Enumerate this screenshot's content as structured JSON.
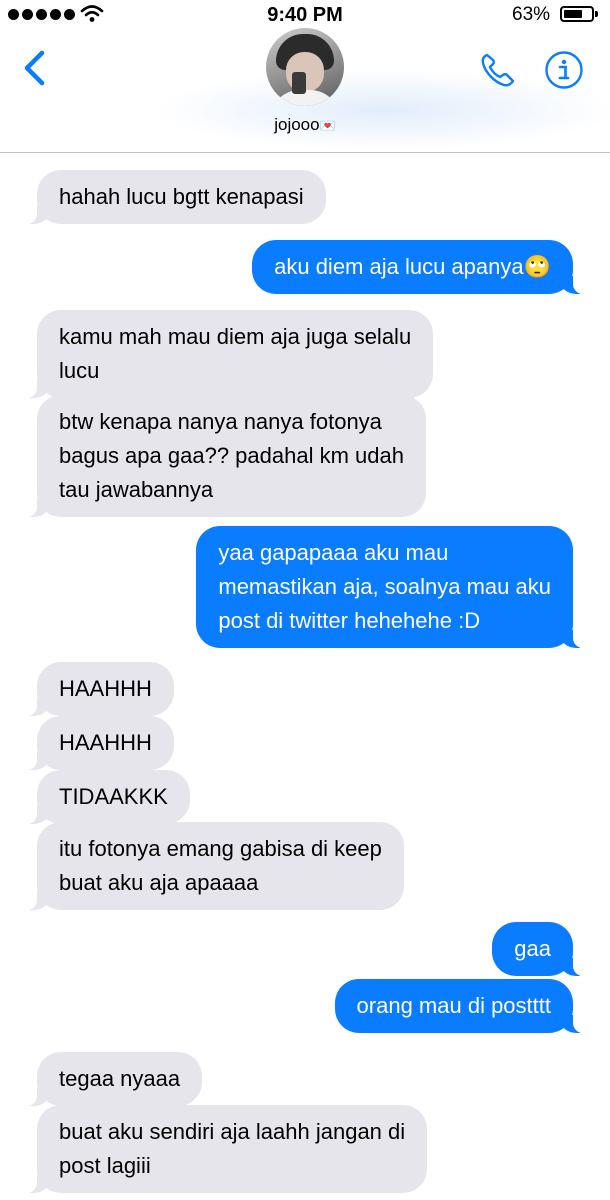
{
  "status_bar": {
    "time": "9:40 PM",
    "battery": "63%"
  },
  "header": {
    "contact_name": "jojooo",
    "heart": "💌"
  },
  "messages": [
    {
      "dir": "in",
      "text": "hahah lucu bgtt kenapasi"
    },
    {
      "dir": "out",
      "text": "aku diem aja lucu apanya🙄"
    },
    {
      "dir": "in",
      "text": "kamu mah mau diem aja juga selalu\nlucu"
    },
    {
      "dir": "in",
      "text": "btw kenapa nanya nanya fotonya\nbagus apa gaa?? padahal km udah\ntau jawabannya"
    },
    {
      "dir": "out",
      "text": "yaa gapapaaa aku mau\nmemastikan aja, soalnya mau aku\npost di twitter hehehehe :D"
    },
    {
      "dir": "in",
      "text": "HAAHHH"
    },
    {
      "dir": "in",
      "text": "HAAHHH"
    },
    {
      "dir": "in",
      "text": "TIDAAKKK"
    },
    {
      "dir": "in",
      "text": "itu fotonya emang gabisa di keep\nbuat aku aja apaaaa"
    },
    {
      "dir": "out",
      "text": "gaa"
    },
    {
      "dir": "out",
      "text": "orang mau di postttt"
    },
    {
      "dir": "in",
      "text": "tegaa nyaaa"
    },
    {
      "dir": "in",
      "text": "buat aku sendiri aja laahh jangan di\npost lagiii"
    }
  ],
  "colors": {
    "accent": "#0a7cff",
    "incoming_bubble": "#e6e5eb"
  },
  "icons": [
    "back-chevron-icon",
    "phone-icon",
    "info-icon",
    "wifi-icon",
    "battery-icon"
  ]
}
